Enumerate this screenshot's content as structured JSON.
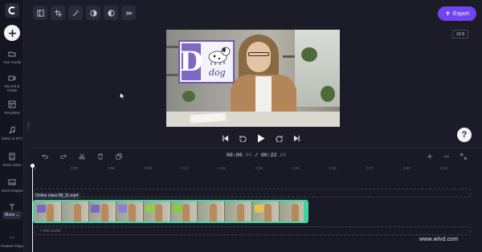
{
  "app": {
    "export_label": "Export",
    "aspect_ratio": "16:9",
    "help_label": "?",
    "accent_color": "#7044ee",
    "clip_border_color": "#3fd2a2"
  },
  "sidebar": {
    "items": [
      {
        "label": "Your media",
        "icon": "folder-icon"
      },
      {
        "label": "Record & create",
        "icon": "camera-icon"
      },
      {
        "label": "Templates",
        "icon": "templates-icon"
      },
      {
        "label": "Music & SFX",
        "icon": "music-icon"
      },
      {
        "label": "Stock video",
        "icon": "film-icon"
      },
      {
        "label": "Stock images",
        "icon": "image-icon"
      },
      {
        "label": "Text",
        "icon": "text-icon"
      },
      {
        "label": "Feature Flags",
        "icon": "flag-icon"
      }
    ],
    "more_label": "More"
  },
  "toolbar": {
    "tools": [
      "layout-icon",
      "crop-icon",
      "magic-icon",
      "contrast-icon",
      "filter-icon",
      "speed-icon"
    ]
  },
  "preview": {
    "card_letter": "D",
    "card_word": "dog"
  },
  "timeline": {
    "current_time": "00:00",
    "current_frames": ".00",
    "separator": "/",
    "total_time": "00:22",
    "total_frames": ".69",
    "ticks": [
      "0",
      "0:03",
      "0:06",
      "0:09",
      "0:12",
      "0:15",
      "0:18",
      "0:21",
      "0:24",
      "0:27",
      "0:30",
      "0:33"
    ],
    "clip_label": "Online class 08_11.mp4",
    "add_audio_label": "+ Add audio"
  },
  "watermark": "www.wlvd.com"
}
